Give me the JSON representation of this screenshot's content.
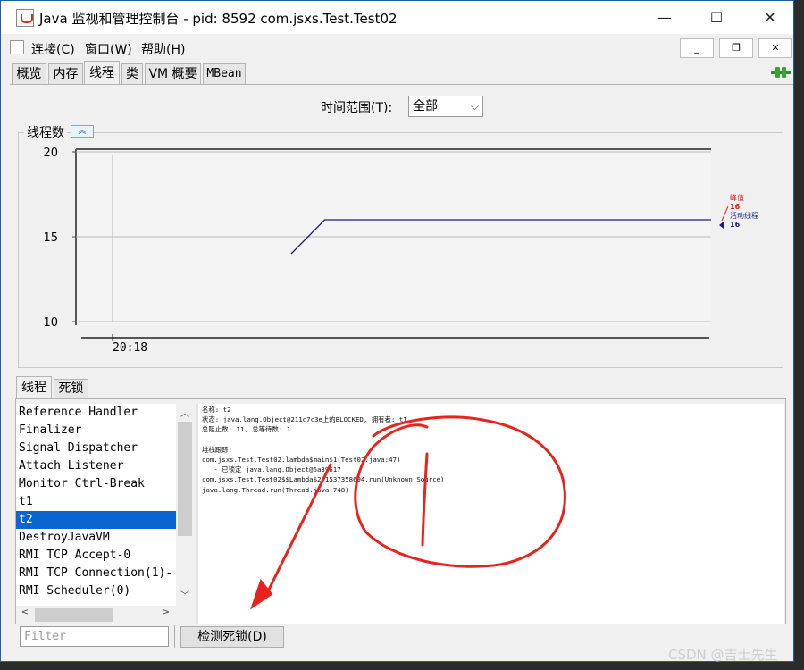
{
  "window": {
    "title": "Java 监视和管理控制台 - pid: 8592 com.jsxs.Test.Test02",
    "controls": {
      "minimize": "—",
      "maximize": "☐",
      "close": "✕"
    }
  },
  "menu": {
    "items": [
      "连接(C)",
      "窗口(W)",
      "帮助(H)"
    ],
    "mdi": {
      "minimize": "_",
      "restore": "❐",
      "close": "✕"
    }
  },
  "tabs": [
    "概览",
    "内存",
    "线程",
    "类",
    "VM 概要",
    "MBean"
  ],
  "active_tab": "线程",
  "time_range": {
    "label": "时间范围(T):",
    "selected": "全部"
  },
  "chart": {
    "title": "线程数",
    "collapse_icon": "double-chevron-up-icon",
    "legend": {
      "peak_label": "峰值",
      "peak_value": "16",
      "live_label": "活动线程",
      "live_value": "16",
      "peak_color": "#e02020",
      "live_color": "#1a1a8c"
    }
  },
  "chart_data": {
    "type": "line",
    "title": "线程数",
    "ylim": [
      10,
      20
    ],
    "yticks": [
      "20",
      "15",
      "10"
    ],
    "xticks": [
      "20:18"
    ],
    "grid": true,
    "series": [
      {
        "name": "活动线程",
        "color": "#1a1a8c",
        "points": [
          [
            0.0,
            14
          ],
          [
            0.08,
            16
          ],
          [
            1.0,
            16
          ]
        ]
      }
    ]
  },
  "lower_tabs": [
    "线程",
    "死锁"
  ],
  "threads": [
    "Reference Handler",
    "Finalizer",
    "Signal Dispatcher",
    "Attach Listener",
    "Monitor Ctrl-Break",
    "t1",
    "t2",
    "DestroyJavaVM",
    "RMI TCP Accept-0",
    "RMI TCP Connection(1)-",
    "RMI Scheduler(0)"
  ],
  "selected_thread": "t2",
  "thread_detail": "名称: t2\n状态: java.lang.Object@211c7c3e上的BLOCKED, 拥有者: t1\n总阻止数: 11, 总等待数: 1\n\n堆栈跟踪:\ncom.jsxs.Test.Test02.lambda$main$1(Test02.java:47)\n   - 已锁定 java.lang.Object@6a39617\ncom.jsxs.Test.Test02$$Lambda$2/1537358694.run(Unknown Source)\njava.lang.Thread.run(Thread.java:748)",
  "filter": {
    "placeholder": "Filter",
    "value": ""
  },
  "detect_button": "检测死锁(D)",
  "watermark": "CSDN @吉士先生",
  "annotation_color": "#e8231d"
}
